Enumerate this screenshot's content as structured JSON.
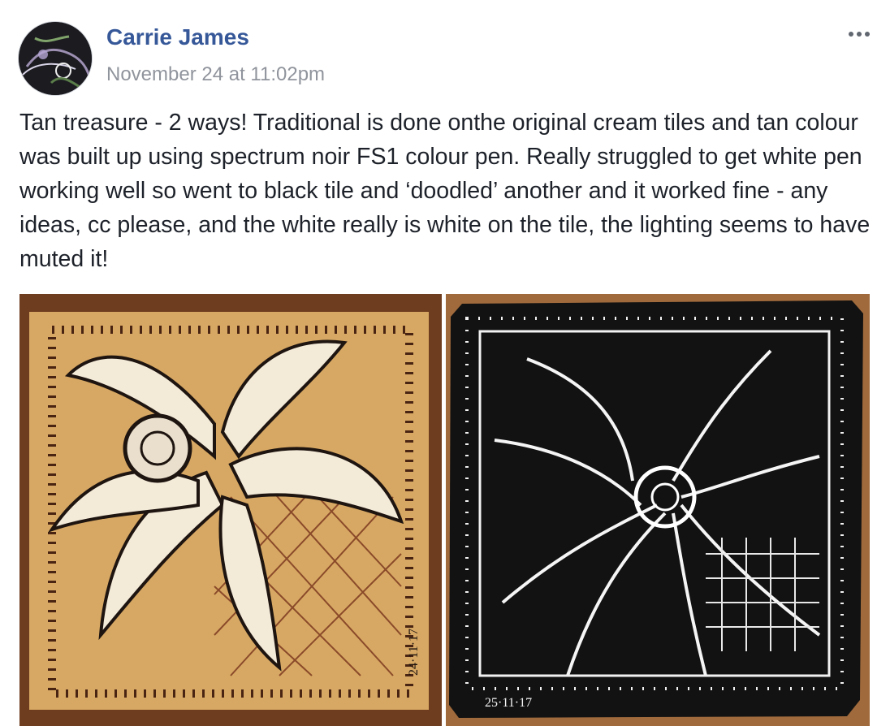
{
  "post": {
    "author_name": "Carrie James",
    "timestamp": "November 24 at 11:02pm",
    "body_text": "Tan treasure - 2 ways! Traditional is done onthe original cream tiles and tan colour was built up using spectrum noir FS1 colour pen. Really struggled to get white pen working well so went to black tile and ‘doodled’ another and it worked fine - any ideas, cc please, and the white really is white on the tile, the lighting seems to have muted it!",
    "more_icon": "more-horizontal-icon"
  },
  "photos": [
    {
      "label": "tan tile artwork",
      "signature": "24·11·17",
      "background_color": "#d7a863",
      "frame_color": "#6e3c1e"
    },
    {
      "label": "black tile artwork",
      "signature": "25·11·17",
      "background_color": "#121212",
      "frame_color": "#a06a3c"
    }
  ],
  "colors": {
    "author_link": "#365899",
    "timestamp": "#90949c",
    "body_text": "#1d2129"
  }
}
